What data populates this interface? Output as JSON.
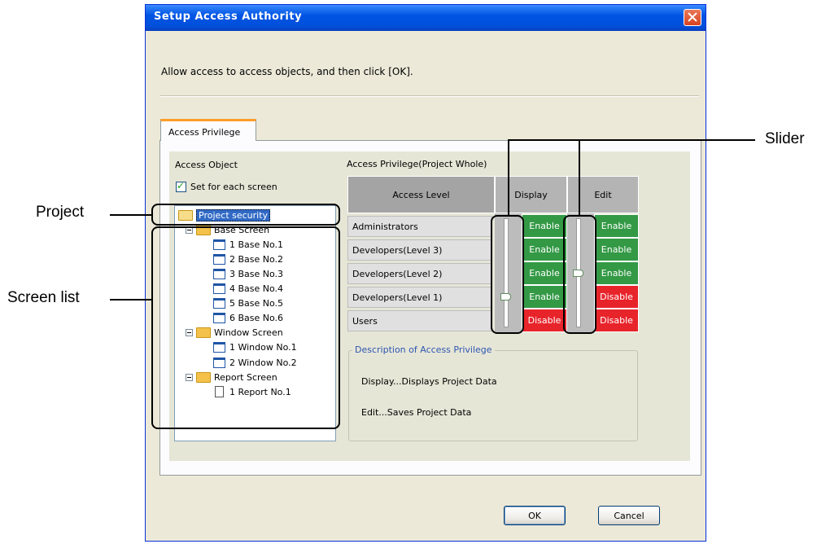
{
  "dialog": {
    "title": "Setup Access Authority",
    "instruction": "Allow access to access objects, and then click [OK].",
    "tab_label": "Access Privilege",
    "buttons": {
      "ok": "OK",
      "cancel": "Cancel"
    }
  },
  "access_object": {
    "heading": "Access Object",
    "checkbox_label": "Set for each screen",
    "checkbox_checked": true,
    "tree": {
      "root": "Project security",
      "groups": [
        {
          "label": "Base Screen",
          "items": [
            "1 Base No.1",
            "2 Base No.2",
            "3 Base No.3",
            "4 Base No.4",
            "5 Base No.5",
            "6 Base No.6"
          ]
        },
        {
          "label": "Window Screen",
          "items": [
            "1 Window No.1",
            "2 Window No.2"
          ]
        },
        {
          "label": "Report Screen",
          "items": [
            "1 Report No.1"
          ]
        }
      ]
    }
  },
  "privilege": {
    "heading": "Access Privilege(Project Whole)",
    "columns": {
      "access_level": "Access Level",
      "display": "Display",
      "edit": "Edit"
    },
    "rows": [
      {
        "level": "Administrators",
        "display": "Enable",
        "edit": "Enable"
      },
      {
        "level": "Developers(Level 3)",
        "display": "Enable",
        "edit": "Enable"
      },
      {
        "level": "Developers(Level 2)",
        "display": "Enable",
        "edit": "Enable"
      },
      {
        "level": "Developers(Level 1)",
        "display": "Enable",
        "edit": "Disable"
      },
      {
        "level": "Users",
        "display": "Disable",
        "edit": "Disable"
      }
    ],
    "display_slider_level": "Developers(Level 1)",
    "edit_slider_level": "Developers(Level 2)"
  },
  "description": {
    "legend": "Description of Access Privilege",
    "lines": [
      "Display...Displays Project Data",
      "Edit...Saves Project Data"
    ]
  },
  "annotations": {
    "project": "Project",
    "screen_list": "Screen list",
    "slider": "Slider"
  },
  "colors": {
    "enable": "#339945",
    "disable": "#e8242b",
    "tab_accent": "#ff9d2a",
    "title_bar": "#0054e3"
  }
}
